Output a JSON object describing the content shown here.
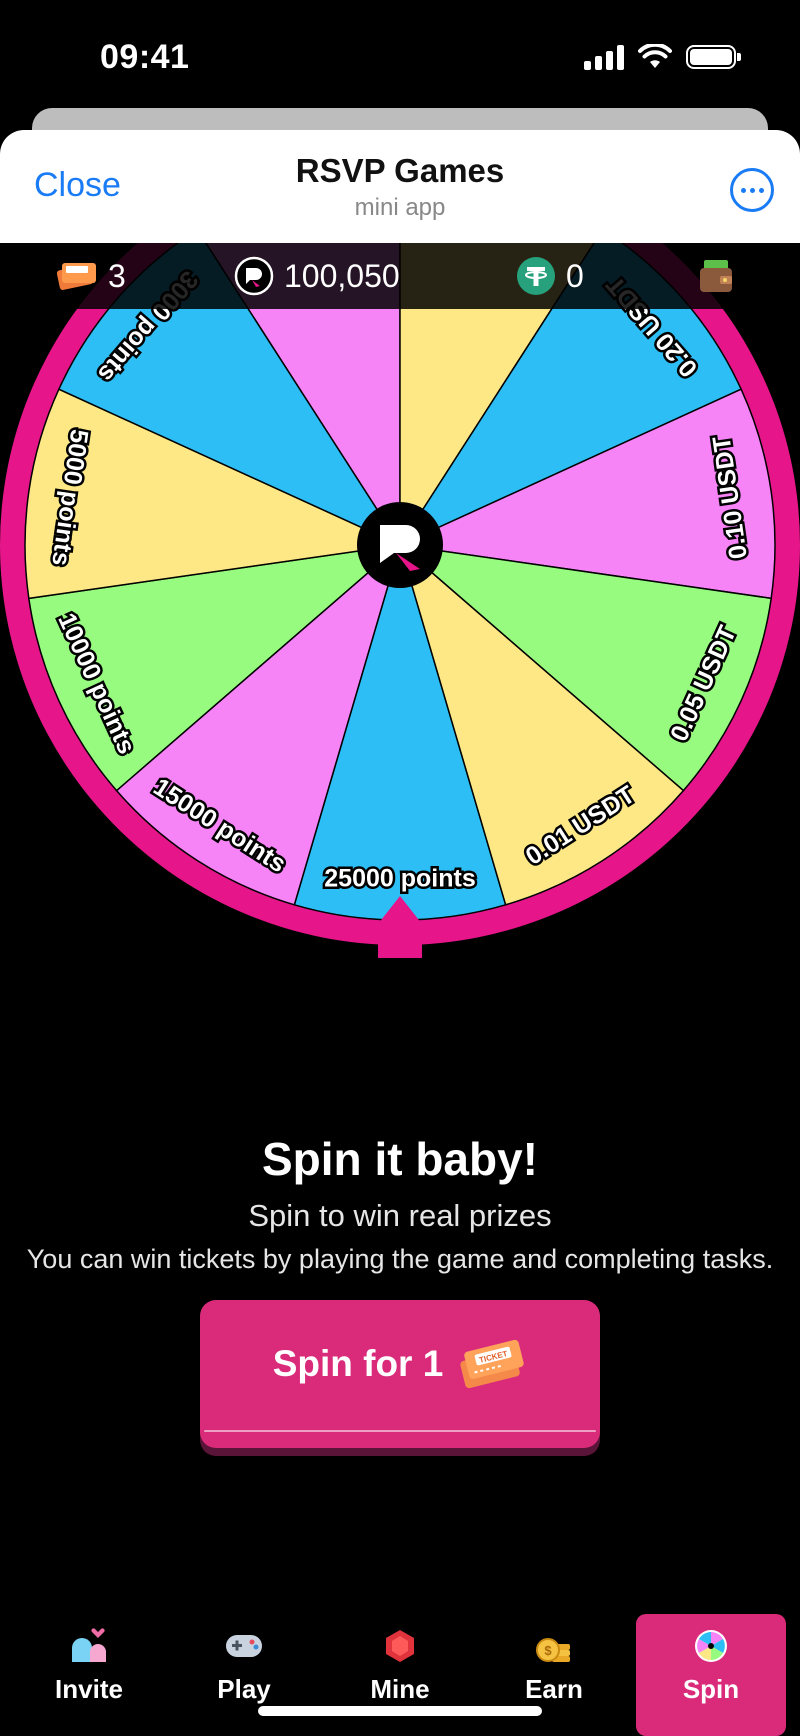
{
  "status": {
    "time": "09:41"
  },
  "header": {
    "close_label": "Close",
    "title": "RSVP Games",
    "subtitle": "mini app"
  },
  "stats": {
    "tickets": "3",
    "points": "100,050",
    "usdt": "0"
  },
  "wheel": {
    "segments": [
      {
        "label": "25000 points",
        "color": "#2dbef5"
      },
      {
        "label": "15000 points",
        "color": "#f684f7"
      },
      {
        "label": "10000 points",
        "color": "#97fb7f"
      },
      {
        "label": "5000 points",
        "color": "#fde885"
      },
      {
        "label": "3000 points",
        "color": "#2dbef5"
      },
      {
        "label": "",
        "color": "#f684f7"
      },
      {
        "label": "",
        "color": "#fde885"
      },
      {
        "label": "0.20 USDT",
        "color": "#2dbef5"
      },
      {
        "label": "0.10 USDT",
        "color": "#f684f7"
      },
      {
        "label": "0.05 USDT",
        "color": "#97fb7f"
      },
      {
        "label": "0.01 USDT",
        "color": "#fde885"
      }
    ],
    "rim_color": "#e6168a",
    "center_color": "#000000"
  },
  "main": {
    "title": "Spin it baby!",
    "subtitle": "Spin to win real prizes",
    "description": "You can win tickets by playing the game and completing tasks."
  },
  "spin_button": {
    "label": "Spin for 1",
    "ticket_text": "TICKET"
  },
  "tabs": [
    {
      "label": "Invite",
      "icon": "invite-icon",
      "active": false
    },
    {
      "label": "Play",
      "icon": "gamepad-icon",
      "active": false
    },
    {
      "label": "Mine",
      "icon": "gem-icon",
      "active": false
    },
    {
      "label": "Earn",
      "icon": "coins-icon",
      "active": false
    },
    {
      "label": "Spin",
      "icon": "wheel-icon",
      "active": true
    }
  ],
  "colors": {
    "accent": "#d92b7a",
    "link": "#1a7cf5"
  }
}
